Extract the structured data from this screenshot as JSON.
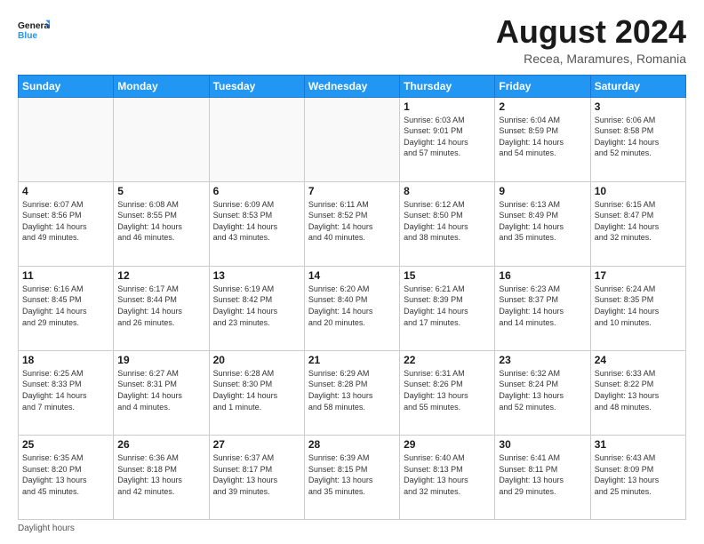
{
  "logo": {
    "line1": "General",
    "line2": "Blue"
  },
  "title": "August 2024",
  "subtitle": "Recea, Maramures, Romania",
  "days_of_week": [
    "Sunday",
    "Monday",
    "Tuesday",
    "Wednesday",
    "Thursday",
    "Friday",
    "Saturday"
  ],
  "footer": "Daylight hours",
  "weeks": [
    [
      {
        "day": "",
        "info": ""
      },
      {
        "day": "",
        "info": ""
      },
      {
        "day": "",
        "info": ""
      },
      {
        "day": "",
        "info": ""
      },
      {
        "day": "1",
        "info": "Sunrise: 6:03 AM\nSunset: 9:01 PM\nDaylight: 14 hours\nand 57 minutes."
      },
      {
        "day": "2",
        "info": "Sunrise: 6:04 AM\nSunset: 8:59 PM\nDaylight: 14 hours\nand 54 minutes."
      },
      {
        "day": "3",
        "info": "Sunrise: 6:06 AM\nSunset: 8:58 PM\nDaylight: 14 hours\nand 52 minutes."
      }
    ],
    [
      {
        "day": "4",
        "info": "Sunrise: 6:07 AM\nSunset: 8:56 PM\nDaylight: 14 hours\nand 49 minutes."
      },
      {
        "day": "5",
        "info": "Sunrise: 6:08 AM\nSunset: 8:55 PM\nDaylight: 14 hours\nand 46 minutes."
      },
      {
        "day": "6",
        "info": "Sunrise: 6:09 AM\nSunset: 8:53 PM\nDaylight: 14 hours\nand 43 minutes."
      },
      {
        "day": "7",
        "info": "Sunrise: 6:11 AM\nSunset: 8:52 PM\nDaylight: 14 hours\nand 40 minutes."
      },
      {
        "day": "8",
        "info": "Sunrise: 6:12 AM\nSunset: 8:50 PM\nDaylight: 14 hours\nand 38 minutes."
      },
      {
        "day": "9",
        "info": "Sunrise: 6:13 AM\nSunset: 8:49 PM\nDaylight: 14 hours\nand 35 minutes."
      },
      {
        "day": "10",
        "info": "Sunrise: 6:15 AM\nSunset: 8:47 PM\nDaylight: 14 hours\nand 32 minutes."
      }
    ],
    [
      {
        "day": "11",
        "info": "Sunrise: 6:16 AM\nSunset: 8:45 PM\nDaylight: 14 hours\nand 29 minutes."
      },
      {
        "day": "12",
        "info": "Sunrise: 6:17 AM\nSunset: 8:44 PM\nDaylight: 14 hours\nand 26 minutes."
      },
      {
        "day": "13",
        "info": "Sunrise: 6:19 AM\nSunset: 8:42 PM\nDaylight: 14 hours\nand 23 minutes."
      },
      {
        "day": "14",
        "info": "Sunrise: 6:20 AM\nSunset: 8:40 PM\nDaylight: 14 hours\nand 20 minutes."
      },
      {
        "day": "15",
        "info": "Sunrise: 6:21 AM\nSunset: 8:39 PM\nDaylight: 14 hours\nand 17 minutes."
      },
      {
        "day": "16",
        "info": "Sunrise: 6:23 AM\nSunset: 8:37 PM\nDaylight: 14 hours\nand 14 minutes."
      },
      {
        "day": "17",
        "info": "Sunrise: 6:24 AM\nSunset: 8:35 PM\nDaylight: 14 hours\nand 10 minutes."
      }
    ],
    [
      {
        "day": "18",
        "info": "Sunrise: 6:25 AM\nSunset: 8:33 PM\nDaylight: 14 hours\nand 7 minutes."
      },
      {
        "day": "19",
        "info": "Sunrise: 6:27 AM\nSunset: 8:31 PM\nDaylight: 14 hours\nand 4 minutes."
      },
      {
        "day": "20",
        "info": "Sunrise: 6:28 AM\nSunset: 8:30 PM\nDaylight: 14 hours\nand 1 minute."
      },
      {
        "day": "21",
        "info": "Sunrise: 6:29 AM\nSunset: 8:28 PM\nDaylight: 13 hours\nand 58 minutes."
      },
      {
        "day": "22",
        "info": "Sunrise: 6:31 AM\nSunset: 8:26 PM\nDaylight: 13 hours\nand 55 minutes."
      },
      {
        "day": "23",
        "info": "Sunrise: 6:32 AM\nSunset: 8:24 PM\nDaylight: 13 hours\nand 52 minutes."
      },
      {
        "day": "24",
        "info": "Sunrise: 6:33 AM\nSunset: 8:22 PM\nDaylight: 13 hours\nand 48 minutes."
      }
    ],
    [
      {
        "day": "25",
        "info": "Sunrise: 6:35 AM\nSunset: 8:20 PM\nDaylight: 13 hours\nand 45 minutes."
      },
      {
        "day": "26",
        "info": "Sunrise: 6:36 AM\nSunset: 8:18 PM\nDaylight: 13 hours\nand 42 minutes."
      },
      {
        "day": "27",
        "info": "Sunrise: 6:37 AM\nSunset: 8:17 PM\nDaylight: 13 hours\nand 39 minutes."
      },
      {
        "day": "28",
        "info": "Sunrise: 6:39 AM\nSunset: 8:15 PM\nDaylight: 13 hours\nand 35 minutes."
      },
      {
        "day": "29",
        "info": "Sunrise: 6:40 AM\nSunset: 8:13 PM\nDaylight: 13 hours\nand 32 minutes."
      },
      {
        "day": "30",
        "info": "Sunrise: 6:41 AM\nSunset: 8:11 PM\nDaylight: 13 hours\nand 29 minutes."
      },
      {
        "day": "31",
        "info": "Sunrise: 6:43 AM\nSunset: 8:09 PM\nDaylight: 13 hours\nand 25 minutes."
      }
    ]
  ]
}
